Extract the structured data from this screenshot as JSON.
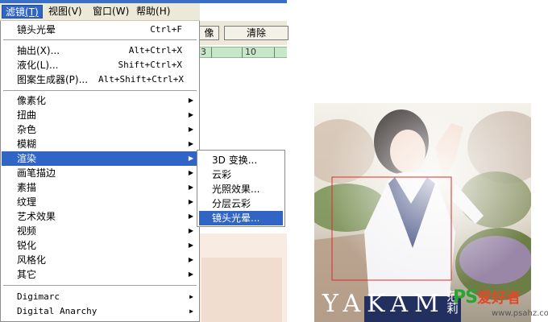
{
  "menubar": {
    "items": [
      {
        "label": "滤镜",
        "accel": "(T)"
      },
      {
        "label": "视图",
        "accel": "(V)"
      },
      {
        "label": "窗口",
        "accel": "(W)"
      },
      {
        "label": "帮助",
        "accel": "(H)"
      }
    ]
  },
  "toolbar": {
    "partial_button_label": "像",
    "clear_button_label": "清除"
  },
  "ruler": {
    "label_a": "3",
    "label_b": "10"
  },
  "filter_menu": {
    "last_filter": {
      "label": "镜头光晕",
      "shortcut": "Ctrl+F"
    },
    "group2": [
      {
        "label": "抽出(X)...",
        "shortcut": "Alt+Ctrl+X"
      },
      {
        "label": "液化(L)...",
        "shortcut": "Shift+Ctrl+X"
      },
      {
        "label": "图案生成器(P)...",
        "shortcut": "Alt+Shift+Ctrl+X"
      }
    ],
    "group3": [
      {
        "label": "像素化"
      },
      {
        "label": "扭曲"
      },
      {
        "label": "杂色"
      },
      {
        "label": "模糊"
      },
      {
        "label": "渲染"
      },
      {
        "label": "画笔描边"
      },
      {
        "label": "素描"
      },
      {
        "label": "纹理"
      },
      {
        "label": "艺术效果"
      },
      {
        "label": "视频"
      },
      {
        "label": "锐化"
      },
      {
        "label": "风格化"
      },
      {
        "label": "其它"
      }
    ],
    "group4": [
      {
        "label": "Digimarc"
      },
      {
        "label": "Digital Anarchy"
      }
    ],
    "highlighted": "渲染"
  },
  "render_submenu": {
    "items": [
      {
        "label": "3D 变换..."
      },
      {
        "label": "云彩"
      },
      {
        "label": "光照效果..."
      },
      {
        "label": "分层云彩"
      },
      {
        "label": "镜头光晕..."
      }
    ],
    "highlighted": "镜头光晕..."
  },
  "photo": {
    "caption": "YAKAM",
    "signature": "范莉",
    "watermark": {
      "ps": "PS",
      "cn": "爱好者",
      "url": "www.psahz.com"
    }
  },
  "colors": {
    "highlight": "#3165c5",
    "menubar_bg": "#ece9d8",
    "ruler_bg": "#c8e7c8",
    "selection_rect": "#d9302a"
  }
}
